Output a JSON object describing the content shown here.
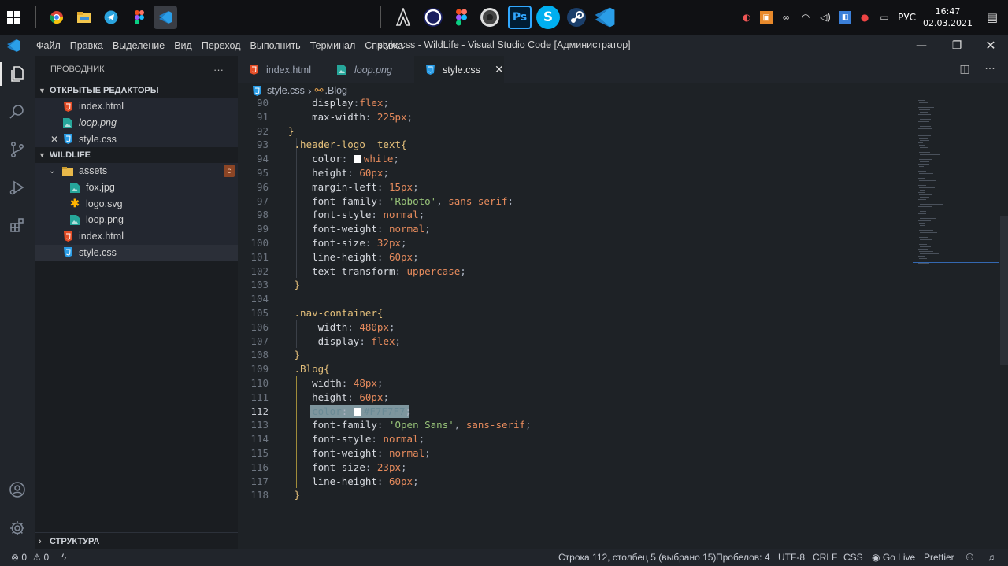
{
  "taskbar": {
    "apps": [
      {
        "name": "windows-start-icon"
      },
      {
        "name": "chrome-icon"
      },
      {
        "name": "file-explorer-icon"
      },
      {
        "name": "telegram-icon"
      },
      {
        "name": "figma-icon"
      },
      {
        "name": "vscode-icon"
      }
    ],
    "pinned": [
      {
        "name": "assassins-creed-icon"
      },
      {
        "name": "cinema4d-icon"
      },
      {
        "name": "figma-icon"
      },
      {
        "name": "audio-app-icon"
      },
      {
        "name": "photoshop-icon",
        "label": "Ps"
      },
      {
        "name": "skype-icon",
        "label": "S"
      },
      {
        "name": "steam-icon"
      },
      {
        "name": "vscode-icon"
      }
    ],
    "tray": {
      "language": "РУС",
      "time": "16:47",
      "date": "02.03.2021"
    }
  },
  "window": {
    "title": "style.css - WildLife - Visual Studio Code [Администратор]",
    "menus": [
      "Файл",
      "Правка",
      "Выделение",
      "Вид",
      "Переход",
      "Выполнить",
      "Терминал",
      "Справка"
    ]
  },
  "sidebar": {
    "header": "ПРОВОДНИК",
    "more": "···",
    "open_editors_title": "ОТКРЫТЫЕ РЕДАКТОРЫ",
    "open_editors": [
      {
        "label": "index.html",
        "icon": "html-file-icon"
      },
      {
        "label": "loop.png",
        "icon": "image-file-icon"
      },
      {
        "label": "style.css",
        "icon": "css-file-icon"
      }
    ],
    "project_title": "WILDLIFE",
    "tree": [
      {
        "label": "assets",
        "icon": "folder-icon",
        "badge": "c"
      },
      {
        "label": "fox.jpg",
        "icon": "image-file-icon"
      },
      {
        "label": "logo.svg",
        "icon": "svg-file-icon"
      },
      {
        "label": "loop.png",
        "icon": "image-file-icon"
      },
      {
        "label": "index.html",
        "icon": "html-file-icon"
      },
      {
        "label": "style.css",
        "icon": "css-file-icon"
      }
    ],
    "outline_title": "СТРУКТУРА"
  },
  "tabs": [
    {
      "label": "index.html",
      "icon": "html-file-icon"
    },
    {
      "label": "loop.png",
      "icon": "image-file-icon"
    },
    {
      "label": "style.css",
      "icon": "css-file-icon",
      "close": "✕"
    }
  ],
  "breadcrumb": {
    "file": "style.css",
    "separator": "›",
    "symbol": ".Blog"
  },
  "editor": {
    "current_line": 112,
    "lines": [
      {
        "n": "90",
        "tokens": [
          [
            "    ",
            "p"
          ],
          [
            "display",
            "prop"
          ],
          [
            ":",
            "p"
          ],
          [
            "flex",
            "val"
          ],
          [
            ";",
            "p"
          ]
        ]
      },
      {
        "n": "91",
        "tokens": [
          [
            "    ",
            "p"
          ],
          [
            "max-width",
            "prop"
          ],
          [
            ": ",
            "p"
          ],
          [
            "225px",
            "val"
          ],
          [
            ";",
            "p"
          ]
        ]
      },
      {
        "n": "92",
        "tokens": [
          [
            "}",
            "brace"
          ]
        ]
      },
      {
        "n": "93",
        "tokens": [
          [
            " ",
            "p"
          ],
          [
            ".header-logo__text",
            "sel"
          ],
          [
            "{",
            "brace"
          ]
        ]
      },
      {
        "n": "94",
        "tokens": [
          [
            "    ",
            "p"
          ],
          [
            "color",
            "prop"
          ],
          [
            ": ",
            "p"
          ],
          [
            "#swatch#",
            "sw"
          ],
          [
            "white",
            "val"
          ],
          [
            ";",
            "p"
          ]
        ]
      },
      {
        "n": "95",
        "tokens": [
          [
            "    ",
            "p"
          ],
          [
            "height",
            "prop"
          ],
          [
            ": ",
            "p"
          ],
          [
            "60px",
            "val"
          ],
          [
            ";",
            "p"
          ]
        ]
      },
      {
        "n": "96",
        "tokens": [
          [
            "    ",
            "p"
          ],
          [
            "margin-left",
            "prop"
          ],
          [
            ": ",
            "p"
          ],
          [
            "15px",
            "val"
          ],
          [
            ";",
            "p"
          ]
        ]
      },
      {
        "n": "97",
        "tokens": [
          [
            "    ",
            "p"
          ],
          [
            "font-family",
            "prop"
          ],
          [
            ": ",
            "p"
          ],
          [
            "'Roboto'",
            "str"
          ],
          [
            ", ",
            "p"
          ],
          [
            "sans-serif",
            "val"
          ],
          [
            ";",
            "p"
          ]
        ]
      },
      {
        "n": "98",
        "tokens": [
          [
            "    ",
            "p"
          ],
          [
            "font-style",
            "prop"
          ],
          [
            ": ",
            "p"
          ],
          [
            "normal",
            "val"
          ],
          [
            ";",
            "p"
          ]
        ]
      },
      {
        "n": "99",
        "tokens": [
          [
            "    ",
            "p"
          ],
          [
            "font-weight",
            "prop"
          ],
          [
            ": ",
            "p"
          ],
          [
            "normal",
            "val"
          ],
          [
            ";",
            "p"
          ]
        ]
      },
      {
        "n": "100",
        "tokens": [
          [
            "    ",
            "p"
          ],
          [
            "font-size",
            "prop"
          ],
          [
            ": ",
            "p"
          ],
          [
            "32px",
            "val"
          ],
          [
            ";",
            "p"
          ]
        ]
      },
      {
        "n": "101",
        "tokens": [
          [
            "    ",
            "p"
          ],
          [
            "line-height",
            "prop"
          ],
          [
            ": ",
            "p"
          ],
          [
            "60px",
            "val"
          ],
          [
            ";",
            "p"
          ]
        ]
      },
      {
        "n": "102",
        "tokens": [
          [
            "    ",
            "p"
          ],
          [
            "text-transform",
            "prop"
          ],
          [
            ": ",
            "p"
          ],
          [
            "uppercase",
            "val"
          ],
          [
            ";",
            "p"
          ]
        ]
      },
      {
        "n": "103",
        "tokens": [
          [
            " ",
            "p"
          ],
          [
            "}",
            "brace"
          ]
        ]
      },
      {
        "n": "104",
        "tokens": []
      },
      {
        "n": "105",
        "tokens": [
          [
            " ",
            "p"
          ],
          [
            ".nav-container",
            "sel"
          ],
          [
            "{",
            "brace"
          ]
        ]
      },
      {
        "n": "106",
        "tokens": [
          [
            "     ",
            "p"
          ],
          [
            "width",
            "prop"
          ],
          [
            ": ",
            "p"
          ],
          [
            "480px",
            "val"
          ],
          [
            ";",
            "p"
          ]
        ]
      },
      {
        "n": "107",
        "tokens": [
          [
            "     ",
            "p"
          ],
          [
            "display",
            "prop"
          ],
          [
            ": ",
            "p"
          ],
          [
            "flex",
            "val"
          ],
          [
            ";",
            "p"
          ]
        ]
      },
      {
        "n": "108",
        "tokens": [
          [
            " ",
            "p"
          ],
          [
            "}",
            "brace"
          ]
        ]
      },
      {
        "n": "109",
        "tokens": [
          [
            " ",
            "p"
          ],
          [
            ".Blog",
            "sel"
          ],
          [
            "{",
            "brace"
          ]
        ]
      },
      {
        "n": "110",
        "tokens": [
          [
            "    ",
            "p"
          ],
          [
            "width",
            "prop"
          ],
          [
            ": ",
            "p"
          ],
          [
            "48px",
            "val"
          ],
          [
            ";",
            "p"
          ]
        ]
      },
      {
        "n": "111",
        "tokens": [
          [
            "    ",
            "p"
          ],
          [
            "height",
            "prop"
          ],
          [
            ": ",
            "p"
          ],
          [
            "60px",
            "val"
          ],
          [
            ";",
            "p"
          ]
        ]
      },
      {
        "n": "112",
        "tokens": [
          [
            "    ",
            "p"
          ],
          [
            "color",
            "prop"
          ],
          [
            ": ",
            "p"
          ],
          [
            "#swatch#",
            "sw"
          ],
          [
            "#F7F7F7",
            "val"
          ],
          [
            ";",
            "p"
          ]
        ]
      },
      {
        "n": "113",
        "tokens": [
          [
            "    ",
            "p"
          ],
          [
            "font-family",
            "prop"
          ],
          [
            ": ",
            "p"
          ],
          [
            "'Open Sans'",
            "str"
          ],
          [
            ", ",
            "p"
          ],
          [
            "sans-serif",
            "val"
          ],
          [
            ";",
            "p"
          ]
        ]
      },
      {
        "n": "114",
        "tokens": [
          [
            "    ",
            "p"
          ],
          [
            "font-style",
            "prop"
          ],
          [
            ": ",
            "p"
          ],
          [
            "normal",
            "val"
          ],
          [
            ";",
            "p"
          ]
        ]
      },
      {
        "n": "115",
        "tokens": [
          [
            "    ",
            "p"
          ],
          [
            "font-weight",
            "prop"
          ],
          [
            ": ",
            "p"
          ],
          [
            "normal",
            "val"
          ],
          [
            ";",
            "p"
          ]
        ]
      },
      {
        "n": "116",
        "tokens": [
          [
            "    ",
            "p"
          ],
          [
            "font-size",
            "prop"
          ],
          [
            ": ",
            "p"
          ],
          [
            "23px",
            "val"
          ],
          [
            ";",
            "p"
          ]
        ]
      },
      {
        "n": "117",
        "tokens": [
          [
            "    ",
            "p"
          ],
          [
            "line-height",
            "prop"
          ],
          [
            ": ",
            "p"
          ],
          [
            "60px",
            "val"
          ],
          [
            ";",
            "p"
          ]
        ]
      },
      {
        "n": "118",
        "tokens": [
          [
            " ",
            "p"
          ],
          [
            "}",
            "brace"
          ]
        ]
      }
    ]
  },
  "statusbar": {
    "errors": "0",
    "warnings": "0",
    "position": "Строка 112, столбец 5 (выбрано 15)",
    "spaces": "Пробелов: 4",
    "encoding": "UTF-8",
    "eol": "CRLF",
    "language": "CSS",
    "golive": "Go Live",
    "prettier": "Prettier"
  },
  "colors": {
    "editor_bg": "#1e2226",
    "sidebar_bg": "#1a1d21",
    "chrome_bg": "#21252b",
    "selector": "#e5c07b",
    "value": "#e58a5c",
    "string": "#98c379",
    "vscode_blue": "#2a9ee8"
  }
}
